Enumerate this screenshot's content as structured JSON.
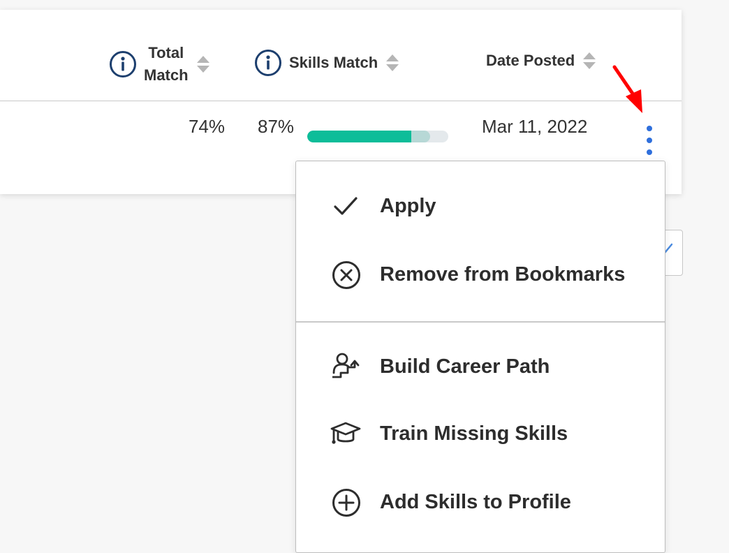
{
  "table": {
    "headers": {
      "total_match_line1": "Total",
      "total_match_line2": "Match",
      "skills_match": "Skills Match",
      "date_posted": "Date Posted"
    },
    "row": {
      "total_match": "74%",
      "skills_match": "87%",
      "skills_match_fraction": 0.87,
      "skills_primary_fraction": 0.74,
      "date_posted": "Mar 11, 2022"
    }
  },
  "menu": {
    "items": [
      {
        "label": "Apply",
        "icon": "check-icon"
      },
      {
        "label": "Remove from Bookmarks",
        "icon": "circle-x-icon"
      },
      {
        "label": "Build Career Path",
        "icon": "career-path-icon"
      },
      {
        "label": "Train Missing Skills",
        "icon": "graduation-cap-icon"
      },
      {
        "label": "Add Skills to Profile",
        "icon": "circle-plus-icon"
      }
    ]
  },
  "colors": {
    "progress_primary": "#0dbd99",
    "progress_secondary": "#b7d8d6",
    "kebab": "#2f6fdc",
    "info_icon": "#1d3f6e",
    "arrow": "#ff0000"
  }
}
